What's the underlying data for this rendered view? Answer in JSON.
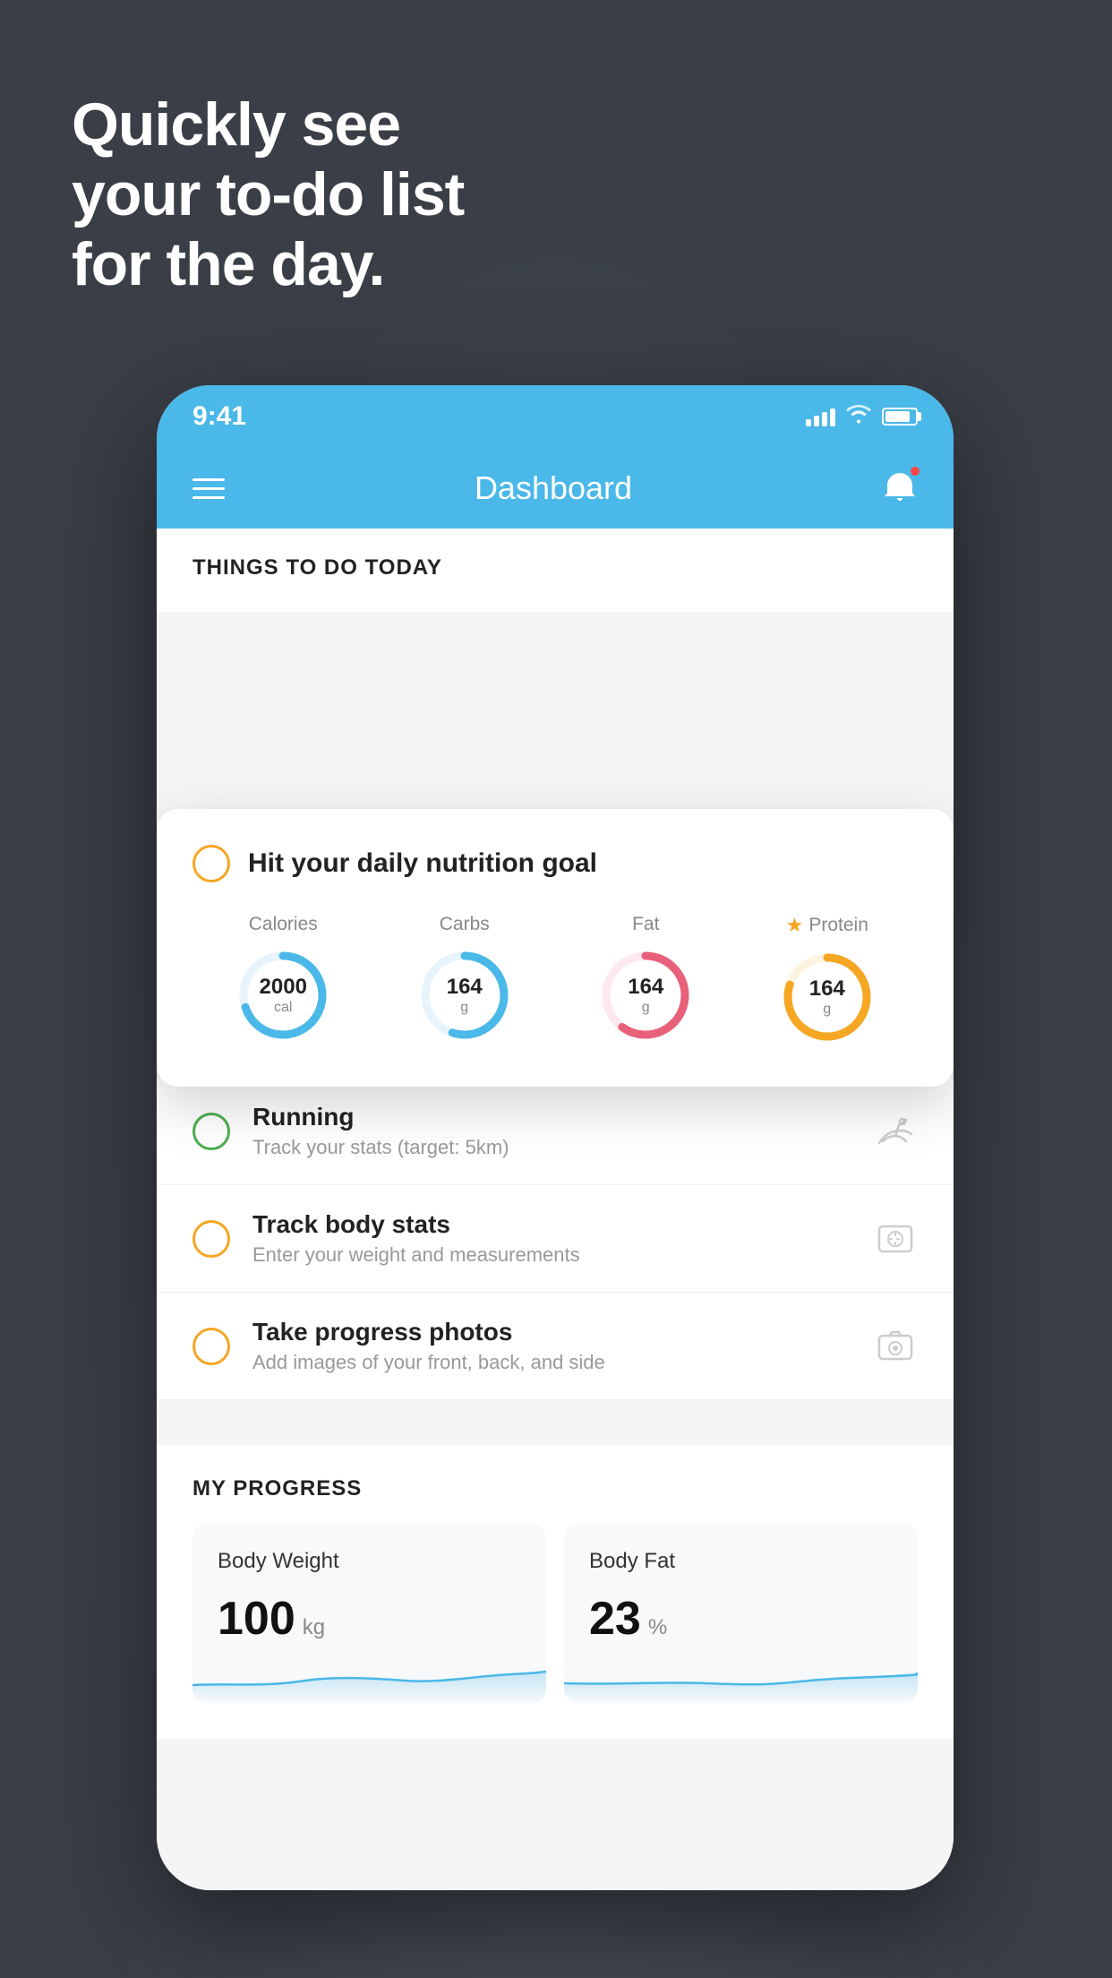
{
  "hero": {
    "line1": "Quickly see",
    "line2": "your to-do list",
    "line3": "for the day."
  },
  "statusBar": {
    "time": "9:41"
  },
  "header": {
    "title": "Dashboard"
  },
  "thingsSection": {
    "title": "THINGS TO DO TODAY"
  },
  "nutritionCard": {
    "title": "Hit your daily nutrition goal",
    "macros": [
      {
        "label": "Calories",
        "value": "2000",
        "unit": "cal",
        "color": "#4ab8e8",
        "percent": 70
      },
      {
        "label": "Carbs",
        "value": "164",
        "unit": "g",
        "color": "#4ab8e8",
        "percent": 55
      },
      {
        "label": "Fat",
        "value": "164",
        "unit": "g",
        "color": "#e8607a",
        "percent": 60
      },
      {
        "label": "Protein",
        "value": "164",
        "unit": "g",
        "color": "#f5a623",
        "percent": 80,
        "starred": true
      }
    ]
  },
  "todoItems": [
    {
      "title": "Running",
      "subtitle": "Track your stats (target: 5km)",
      "checkColor": "green",
      "iconType": "shoe"
    },
    {
      "title": "Track body stats",
      "subtitle": "Enter your weight and measurements",
      "checkColor": "yellow",
      "iconType": "scale"
    },
    {
      "title": "Take progress photos",
      "subtitle": "Add images of your front, back, and side",
      "checkColor": "yellow",
      "iconType": "photo"
    }
  ],
  "progressSection": {
    "title": "MY PROGRESS",
    "cards": [
      {
        "title": "Body Weight",
        "value": "100",
        "unit": "kg"
      },
      {
        "title": "Body Fat",
        "value": "23",
        "unit": "%"
      }
    ]
  }
}
